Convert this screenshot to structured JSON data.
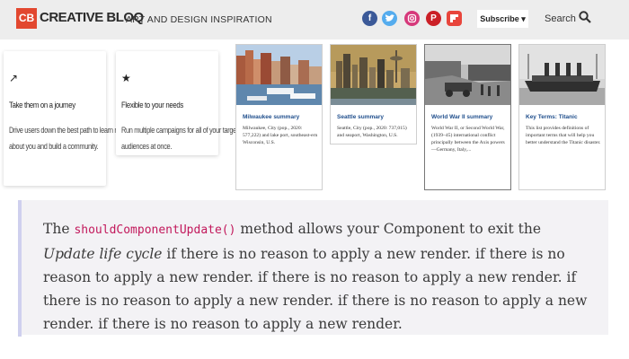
{
  "header": {
    "logo_mark": "CB",
    "logo_text": "CREATIVE BLOQ",
    "tagline": "ART AND DESIGN INSPIRATION",
    "social_icons": [
      "facebook-icon",
      "twitter-icon",
      "instagram-icon",
      "pinterest-icon",
      "flipboard-icon"
    ],
    "subscribe_label": "Subscribe ▾",
    "search_label": "Search"
  },
  "features": [
    {
      "icon": "↗",
      "title": "Take them on a journey",
      "desc_lines": [
        "Drive users down the best path to learn more",
        "about you and build a community."
      ]
    },
    {
      "icon": "★",
      "title": "Flexible to your needs",
      "desc_lines": [
        "Run multiple campaigns for all of your target",
        "audiences at once."
      ]
    }
  ],
  "articles": [
    {
      "title": "Milwaukee summary",
      "desc": "Milwaukee, City (pop., 2020: 577,222) and lake port, southeast-ern Wisconsin, U.S."
    },
    {
      "title": "Seattle summary",
      "desc": "Seattle, City (pop., 2020: 737,015) and seaport, Washington, U.S."
    },
    {
      "title": "World War II summary",
      "desc": "World War II, or Second World War, (1939–45) international conflict principally between the Axis powers—Germany, Italy,..."
    },
    {
      "title": "Key Terms: Titanic",
      "desc": "This list provides definitions of important terms that will help you better understand the Titanic disaster."
    }
  ],
  "quote": {
    "the": "The",
    "code": "shouldComponentUpdate()",
    "mid": "method allows your Component to exit the",
    "emphasis": "Update life cycle",
    "rest": "if there is no reason to apply a new render. if there is no reason to apply a new render. if there is no reason to apply a new render. if there is no reason to apply a new render. if there is no reason to apply a new render. if there is no reason to apply a new render."
  },
  "colors": {
    "brand": "#e2472f",
    "link": "#1f4e8c",
    "code": "#c2185b",
    "quote_bar": "#cfd0ee"
  }
}
